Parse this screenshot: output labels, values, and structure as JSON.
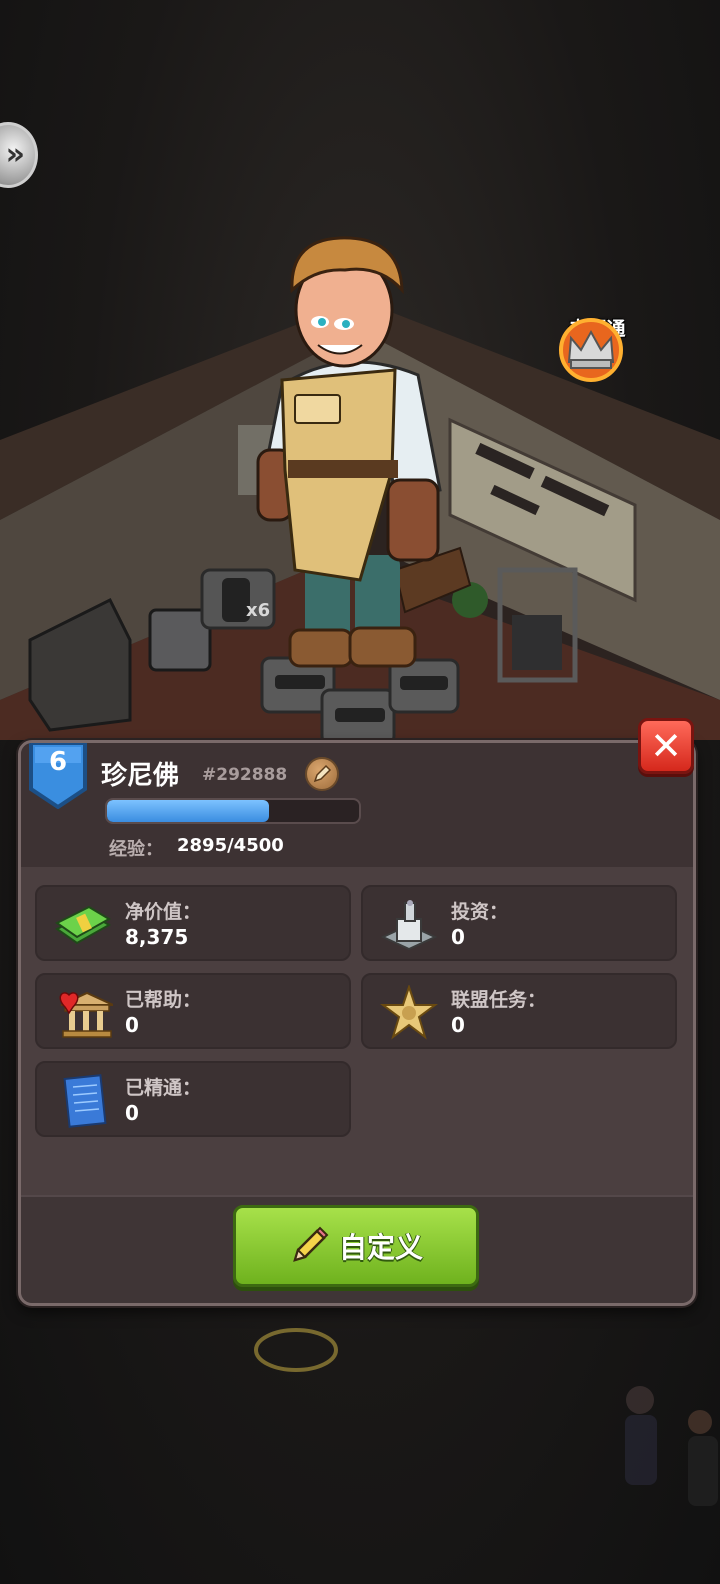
{
  "scene": {
    "back_icon": "double-chevron-right-icon",
    "vip_status_label": "未开通",
    "item_count_label": "x6"
  },
  "profile": {
    "level": "6",
    "name": "珍尼佛",
    "player_id": "#292888",
    "xp_label": "经验：",
    "xp_value": "2895/4500",
    "xp_progress": 0.643
  },
  "stats": [
    {
      "label": "净价值：",
      "value": "8,375",
      "icon": "cash-stack-icon"
    },
    {
      "label": "投资：",
      "value": "0",
      "icon": "building-icon"
    },
    {
      "label": "已帮助：",
      "value": "0",
      "icon": "charity-bank-heart-icon"
    },
    {
      "label": "联盟任务：",
      "value": "0",
      "icon": "sheriff-star-icon"
    },
    {
      "label": "已精通：",
      "value": "0",
      "icon": "blueprint-icon"
    }
  ],
  "actions": {
    "customize_label": "自定义",
    "close_icon": "close-x-icon"
  },
  "colors": {
    "panel_bg": "#4a3e3f",
    "xp_fill": "#4aa0f0",
    "customize_button": "#8cc83a",
    "close_button": "#e53a2c"
  }
}
